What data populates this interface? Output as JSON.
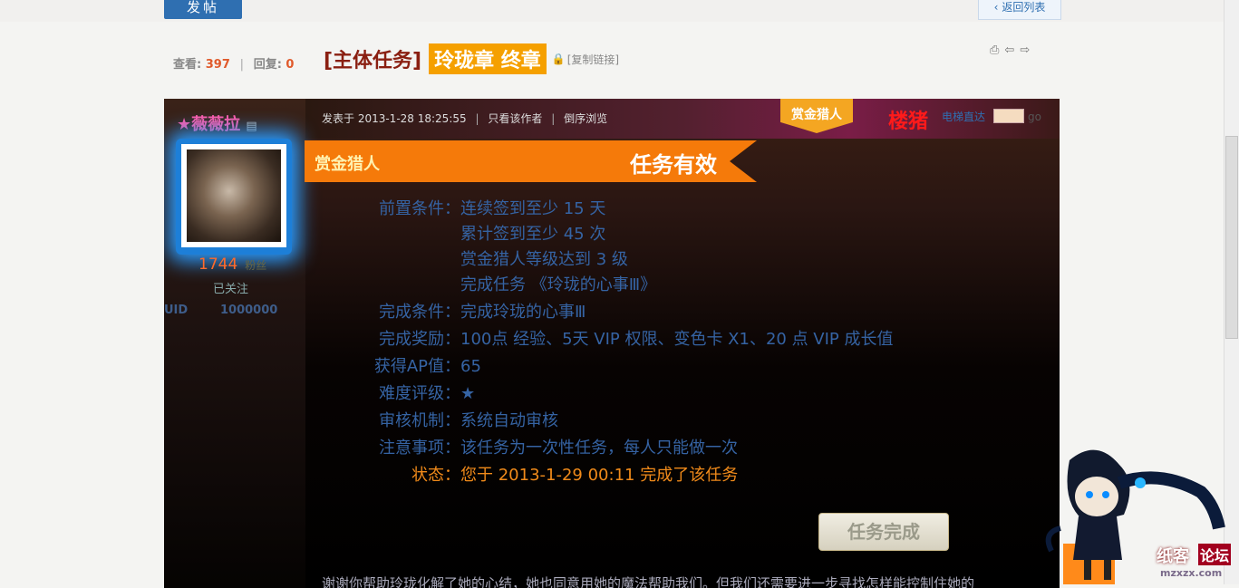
{
  "header": {
    "post_button": "发帖",
    "back_link": "返回列表"
  },
  "thread": {
    "views_label": "查看:",
    "views": "397",
    "replies_label": "回复:",
    "replies": "0",
    "category": "[主体任务]",
    "title_highlight": "玲珑章 终章",
    "copy_link": "[复制链接]"
  },
  "author": {
    "name": "★薇薇拉",
    "credits": "1744",
    "credits_label": "粉丝",
    "followed": "已关注",
    "uid_label": "UID",
    "uid": "1000000"
  },
  "post": {
    "posted_at": "发表于 2013-1-28 18:25:55",
    "only_author": "只看该作者",
    "reverse": "倒序浏览",
    "badge": "赏金猎人",
    "floor": "楼猪",
    "elevator": "电梯直达",
    "go": "go",
    "banner_left": "赏金猎人",
    "banner_right": "任务有效"
  },
  "task": {
    "rows": [
      {
        "label": "前置条件：",
        "value": "连续签到至少 15 天"
      },
      {
        "label": "",
        "value": "累计签到至少 45 次"
      },
      {
        "label": "",
        "value": "赏金猎人等级达到 3 级"
      },
      {
        "label": "",
        "value": "完成任务 《玲珑的心事Ⅲ》"
      },
      {
        "label": "完成条件：",
        "value": "完成玲珑的心事Ⅲ"
      },
      {
        "label": "完成奖励：",
        "value": "100点 经验、5天 VIP 权限、变色卡 X1、20 点 VIP 成长值"
      },
      {
        "label": "获得AP值：",
        "value": "65"
      },
      {
        "label": "难度评级：",
        "value": "★"
      },
      {
        "label": "审核机制：",
        "value": "系统自动审核"
      },
      {
        "label": "注意事项：",
        "value": "该任务为一次性任务，每人只能做一次"
      },
      {
        "label": "状态：",
        "value": "您于 2013-1-29 00:11 完成了该任务"
      }
    ],
    "done_button": "任务完成",
    "bottom_text": "谢谢你帮助玲珑化解了她的心结，她也同意用她的魔法帮助我们。但我们还需要进一步寻找怎样能控制住她的"
  },
  "watermark": {
    "logo_a": "纸客",
    "logo_b": "论坛",
    "url": "mzxzx.com"
  }
}
